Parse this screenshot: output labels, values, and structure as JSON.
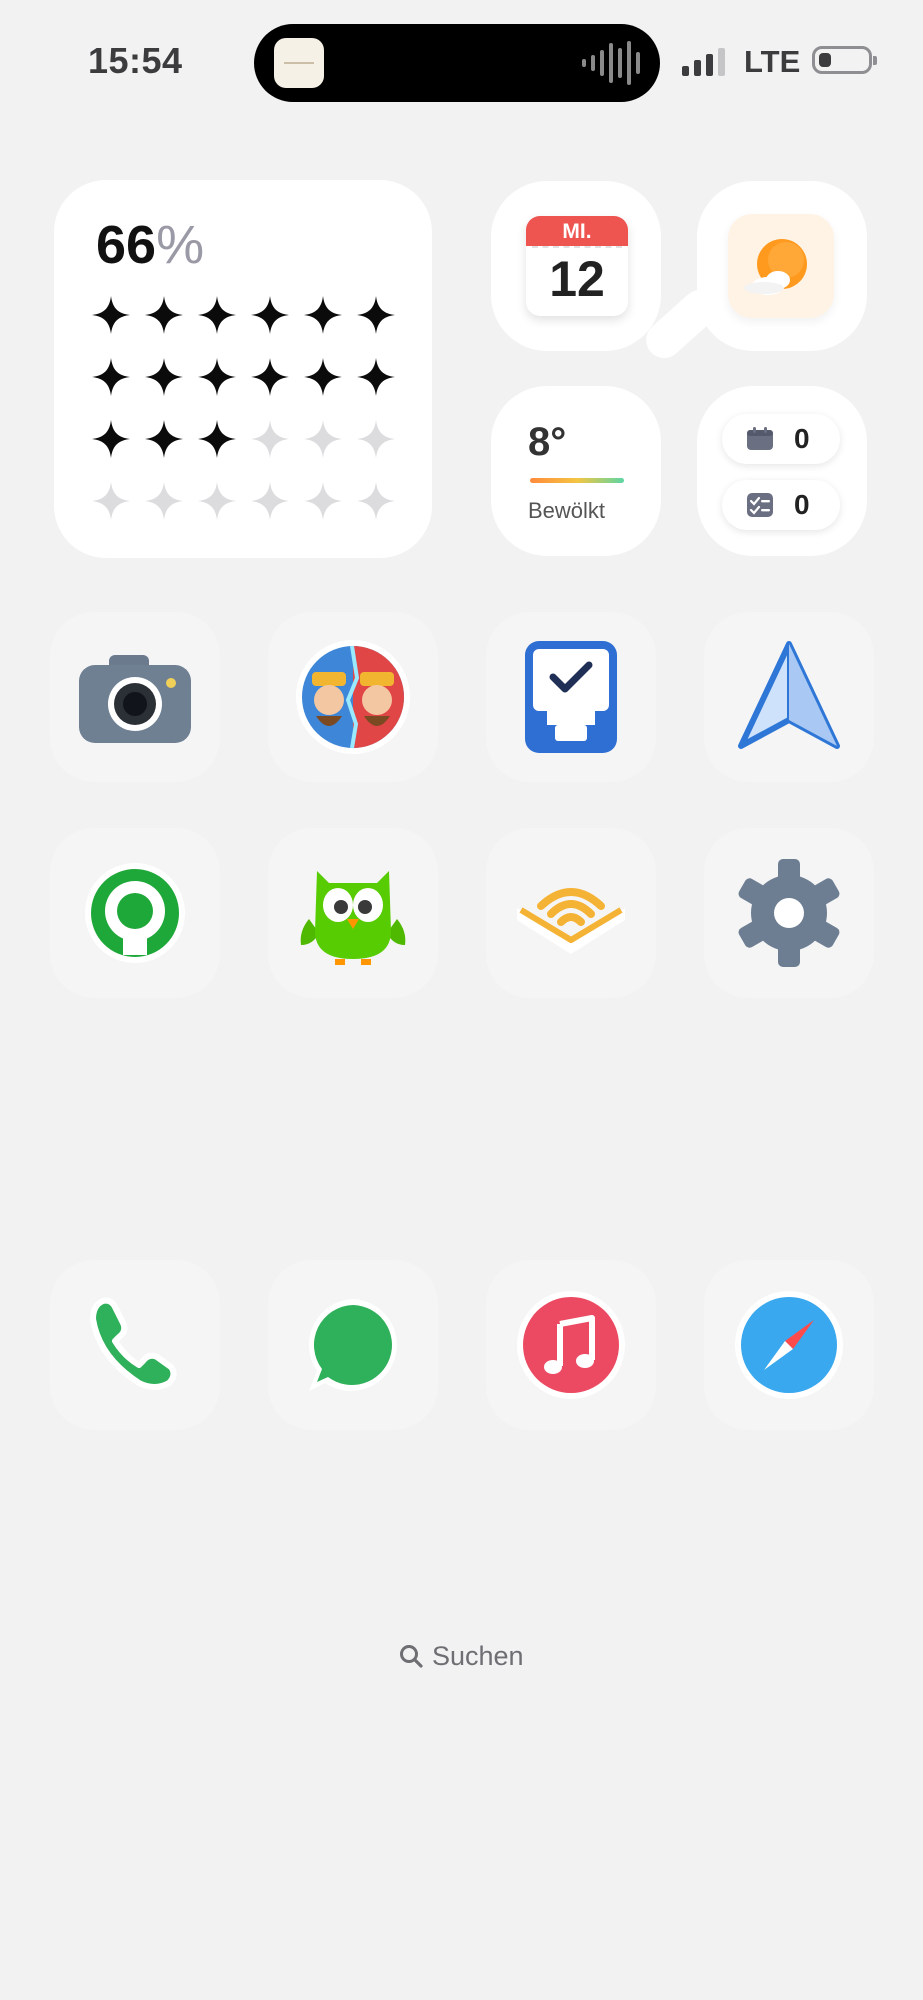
{
  "status_bar": {
    "time": "15:54",
    "network": "LTE",
    "signal_bars": 3,
    "signal_bars_total": 4,
    "battery_percent": 15
  },
  "stars_widget": {
    "percent_value": "66",
    "percent_sign": "%",
    "stars_filled": 15,
    "stars_total": 24
  },
  "calendar_widget": {
    "weekday": "MI.",
    "day": "12"
  },
  "weather_widget": {
    "temperature": "8°",
    "condition": "Bewölkt",
    "icon": "partly-cloudy-sun-icon"
  },
  "counts_widget": {
    "events_count": "0",
    "reminders_count": "0",
    "events_icon": "calendar-icon",
    "reminders_icon": "checklist-icon"
  },
  "home_apps": [
    {
      "icon": "camera-icon"
    },
    {
      "icon": "clash-royale-icon"
    },
    {
      "icon": "things-tasks-icon"
    },
    {
      "icon": "spark-mail-icon"
    },
    {
      "icon": "spotify-style-icon"
    },
    {
      "icon": "duolingo-owl-icon"
    },
    {
      "icon": "audible-icon"
    },
    {
      "icon": "settings-gear-icon"
    }
  ],
  "dock_apps": [
    {
      "icon": "phone-icon"
    },
    {
      "icon": "whatsapp-icon"
    },
    {
      "icon": "music-icon"
    },
    {
      "icon": "safari-compass-icon"
    }
  ],
  "search": {
    "label": "Suchen"
  },
  "colors": {
    "background": "#f2f2f3",
    "calendar_red": "#ee5450",
    "accent_orange": "#ff9a1f",
    "duolingo_green": "#58cc02"
  }
}
